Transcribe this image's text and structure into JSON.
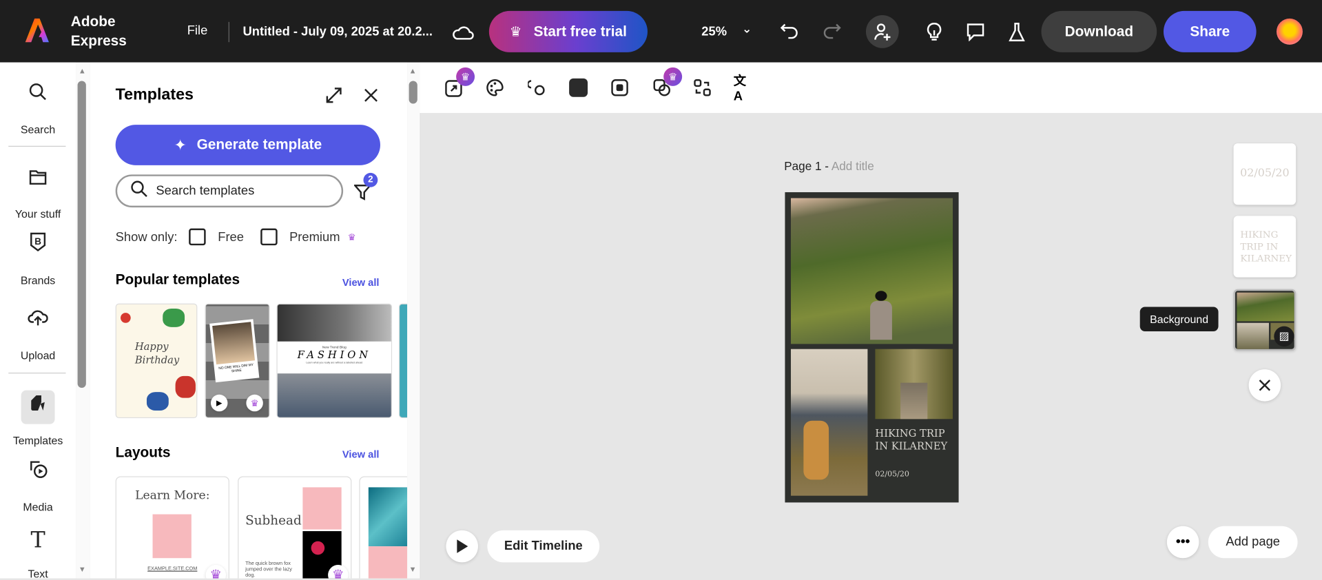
{
  "header": {
    "brand_line1": "Adobe",
    "brand_line2": "Express",
    "file_menu": "File",
    "doc_title": "Untitled - July 09, 2025 at 20.2...",
    "trial_button": "Start free trial",
    "zoom": "25%",
    "download": "Download",
    "share": "Share"
  },
  "rail": {
    "items": [
      {
        "label": "Search",
        "icon": "search-icon"
      },
      {
        "label": "Your stuff",
        "icon": "folder-icon"
      },
      {
        "label": "Brands",
        "icon": "brand-icon"
      },
      {
        "label": "Upload",
        "icon": "upload-icon"
      },
      {
        "label": "Templates",
        "icon": "templates-icon",
        "active": true
      },
      {
        "label": "Media",
        "icon": "media-icon"
      },
      {
        "label": "Text",
        "icon": "text-icon"
      }
    ]
  },
  "panel": {
    "title": "Templates",
    "generate": "Generate template",
    "search_placeholder": "Search templates",
    "filter_count": "2",
    "show_only": "Show only:",
    "free": "Free",
    "premium": "Premium",
    "popular_title": "Popular templates",
    "view_all": "View all",
    "layouts_title": "Layouts",
    "popular": [
      {
        "text1": "Happy",
        "text2": "Birthday"
      },
      {
        "text": "NO ONE WILL DIM MY SHINE"
      },
      {
        "small": "New Trend Blog",
        "text": "FASHION",
        "sub": "Learn what you really are without a labelled ahead"
      }
    ],
    "layouts": [
      {
        "title": "Learn More:",
        "footer": "EXAMPLE.SITE.COM"
      },
      {
        "title": "Subhead",
        "body": "The quick brown fox jumped over the lazy dog."
      }
    ]
  },
  "canvas": {
    "page_label": "Page 1 -",
    "add_title": "Add title",
    "heading": "HIKING TRIP IN KILARNEY",
    "date": "02/05/20"
  },
  "right_thumbs": {
    "date": "02/05/20",
    "heading": "HIKING TRIP IN KILARNEY",
    "tooltip": "Background"
  },
  "bottom": {
    "edit_timeline": "Edit Timeline",
    "add_page": "Add page"
  },
  "colors": {
    "header": "#1e1e1e",
    "accent": "#5258e4",
    "canvas_page": "#2e302d"
  }
}
